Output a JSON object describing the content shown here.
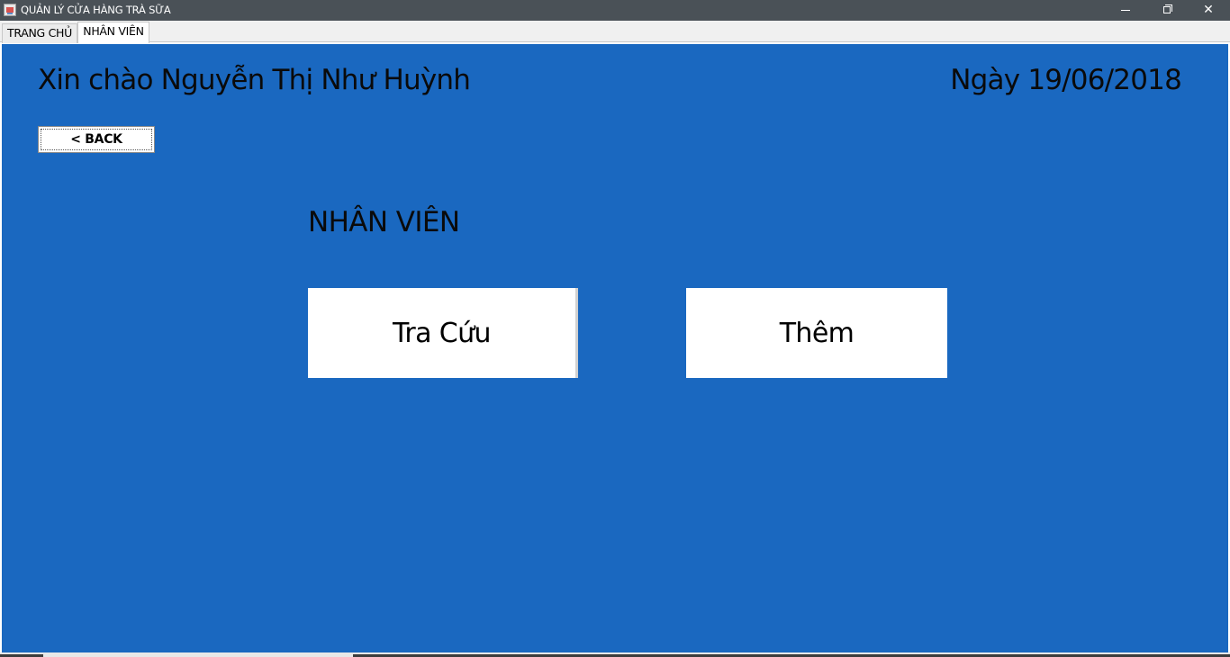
{
  "window": {
    "title": "QUẢN LÝ CỬA HÀNG TRÀ SỮA",
    "icon": "java-app-icon",
    "controls": {
      "minimize_icon": "minimize-icon",
      "maximize_icon": "restore-icon",
      "close_icon": "close-icon",
      "close_glyph": "✕"
    }
  },
  "tabs": [
    {
      "label": "TRANG CHỦ",
      "selected": false
    },
    {
      "label": "NHÂN VIÊN",
      "selected": true
    }
  ],
  "header": {
    "greeting": "Xin chào Nguyễn Thị Như Huỳnh",
    "date": "Ngày 19/06/2018"
  },
  "toolbar": {
    "back_label": "< BACK"
  },
  "main": {
    "section_title": "NHÂN VIÊN",
    "lookup_label": "Tra Cứu",
    "add_label": "Thêm"
  },
  "colors": {
    "panel_background": "#1a68c0",
    "titlebar": "#4a5157",
    "button_background": "#ffffff"
  }
}
